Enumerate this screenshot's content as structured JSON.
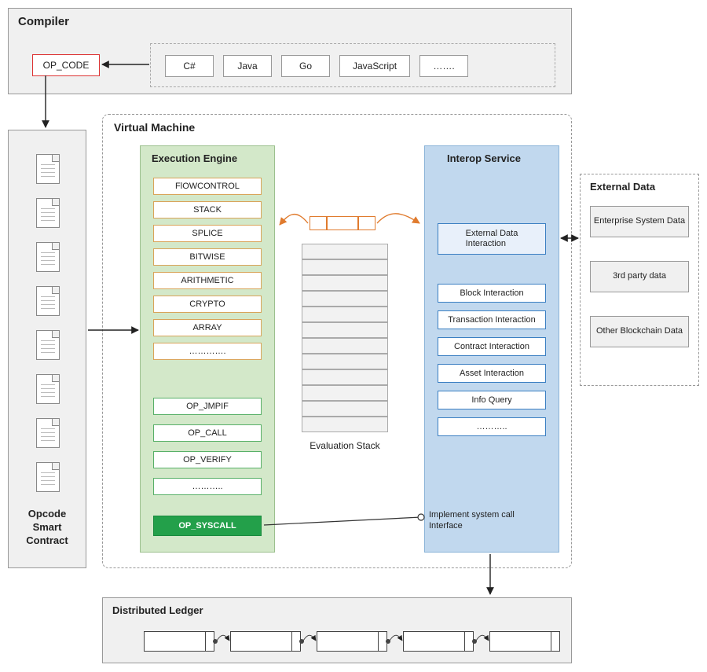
{
  "compiler": {
    "title": "Compiler",
    "opcode_label": "OP_CODE",
    "languages": [
      "C#",
      "Java",
      "Go",
      "JavaScript",
      "……."
    ]
  },
  "opcode_contract": {
    "label": "Opcode\nSmart\nContract"
  },
  "vm": {
    "title": "Virtual Machine",
    "execution_engine": {
      "title": "Execution Engine",
      "categories": [
        "FlOWCONTROL",
        "STACK",
        "SPLICE",
        "BITWISE",
        "ARITHMETIC",
        "CRYPTO",
        "ARRAY",
        "…………."
      ],
      "ops": [
        "OP_JMPIF",
        "OP_CALL",
        "OP_VERIFY",
        "……….."
      ],
      "syscall": "OP_SYSCALL"
    },
    "evaluation_stack": {
      "label": "Evaluation Stack"
    },
    "interop": {
      "title": "Interop Service",
      "external": "External Data\nInteraction",
      "items": [
        "Block Interaction",
        "Transaction Interaction",
        "Contract Interaction",
        "Asset Interaction",
        "Info Query",
        "……….."
      ],
      "syscall_note": "Implement system call\nInterface"
    }
  },
  "external_data": {
    "title": "External Data",
    "items": [
      "Enterprise System Data",
      "3rd party data",
      "Other Blockchain Data"
    ]
  },
  "ledger": {
    "title": "Distributed Ledger"
  }
}
